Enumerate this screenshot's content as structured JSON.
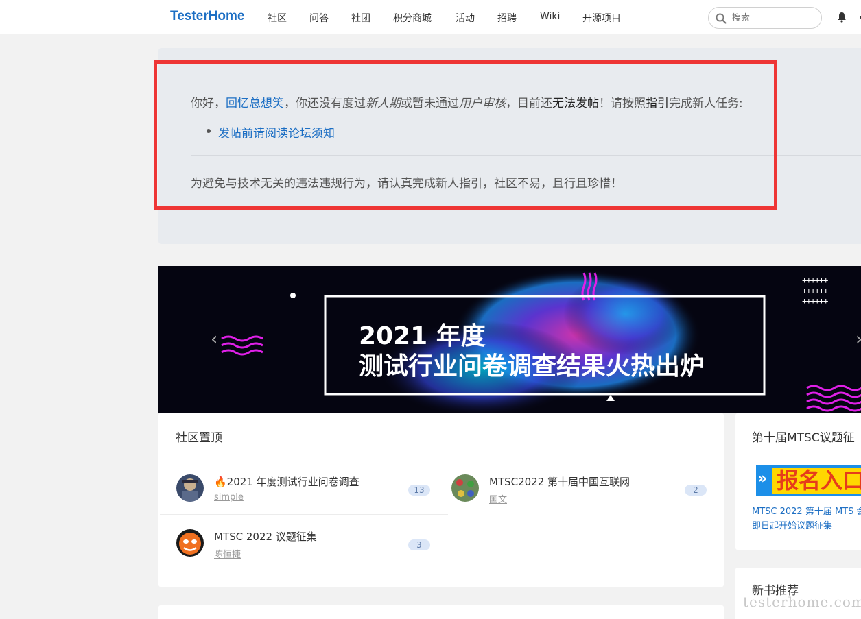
{
  "navbar": {
    "brand": "TesterHome",
    "items": [
      "社区",
      "问答",
      "社团",
      "积分商城",
      "活动",
      "招聘",
      "Wiki",
      "开源项目"
    ],
    "search_placeholder": "搜索"
  },
  "notice": {
    "greeting_prefix": "你好，",
    "username": "回忆总想笑",
    "part1": "，你还没有度过",
    "newbie_period": "新人期",
    "part2": "或暂未通过",
    "user_review": "用户审核",
    "part3": "，目前还",
    "cannot_post": "无法发帖",
    "part4": "！请按照",
    "guide": "指引",
    "part5": "完成新人任务:",
    "bullet_link": "发帖前请阅读论坛须知",
    "footer": "为避免与技术无关的违法违规行为，请认真完成新人指引，社区不易，且行且珍惜！"
  },
  "banner": {
    "title_line1": "2021 年度",
    "title_line2": "测试行业问卷调查结果火热出炉",
    "plus_pattern": "++++++\n++++++\n++++++",
    "prev": "‹",
    "next": "›"
  },
  "pinned": {
    "title": "社区置顶",
    "topics": [
      {
        "title": "🔥2021 年度测试行业问卷调查",
        "author": "simple",
        "replies": "13"
      },
      {
        "title": "MTSC2022 第十届中国互联网",
        "author": "国文",
        "replies": "2"
      },
      {
        "title": "MTSC 2022 议题征集",
        "author": "陈恒捷",
        "replies": "3"
      }
    ]
  },
  "mtsc": {
    "title": "第十届MTSC议题征",
    "signup_text": "报名入口",
    "description": "MTSC 2022 第十届 MTS 会，即日起开始议题征集"
  },
  "book": {
    "title": "新书推荐"
  },
  "watermark": "testerhome.com",
  "colors": {
    "brand": "#1d6fc4",
    "highlight": "#ee3535",
    "banner_bg": "#050511",
    "accent_magenta": "#e020e8"
  }
}
